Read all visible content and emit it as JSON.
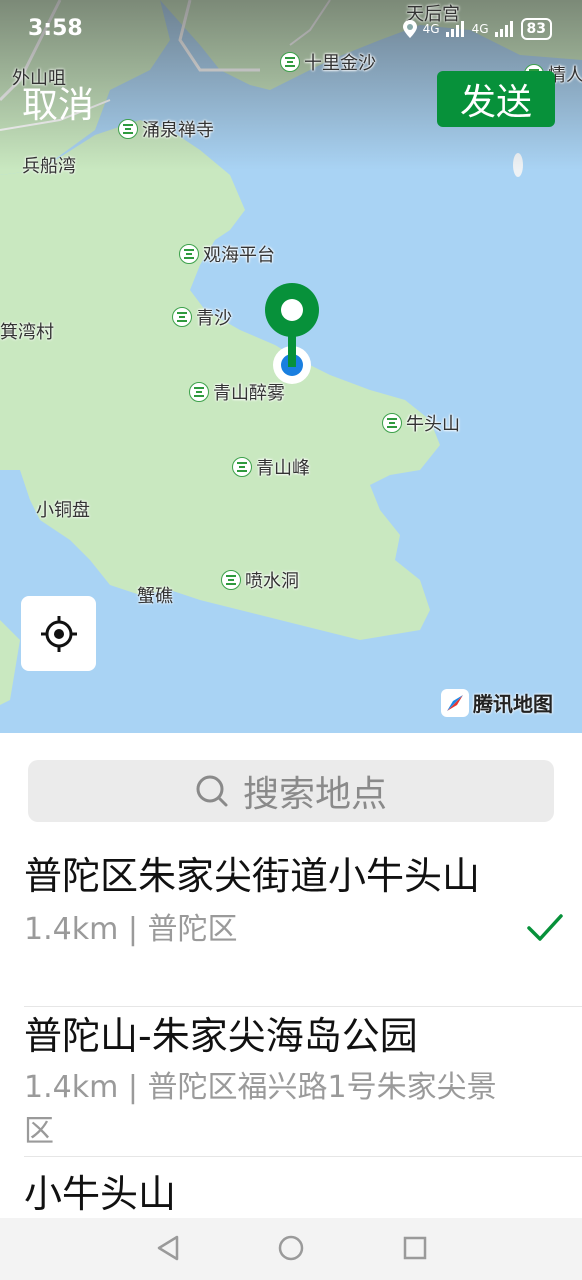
{
  "status": {
    "time": "3:58",
    "battery": "83",
    "network_1": "4G",
    "network_2": "4G"
  },
  "header": {
    "cancel_label": "取消",
    "send_label": "发送"
  },
  "map": {
    "pois": [
      "十里金沙",
      "涌泉禅寺",
      "观海平台",
      "青沙",
      "青山醉雾",
      "牛头山",
      "青山峰",
      "喷水洞",
      "情人"
    ],
    "places": [
      "天后宫",
      "外山咀",
      "兵船湾",
      "箕湾村",
      "小铜盘",
      "蟹礁"
    ],
    "watermark": "腾讯地图",
    "icons": {
      "locate": "crosshair-icon",
      "pin": "map-pin-icon",
      "poi": "scenic-spot-icon"
    },
    "colors": {
      "water": "#a9d3f4",
      "land": "#c9e8c0",
      "pin": "#07913a",
      "location_dot": "#1a7fe0"
    }
  },
  "search": {
    "placeholder": "搜索地点"
  },
  "results": [
    {
      "title": "普陀区朱家尖街道小牛头山",
      "subtitle": "1.4km | 普陀区",
      "selected": true
    },
    {
      "title": "普陀山-朱家尖海岛公园",
      "subtitle": "1.4km | 普陀区福兴路1号朱家尖景区",
      "selected": false
    },
    {
      "title": "小牛头山",
      "subtitle": "",
      "selected": false
    }
  ],
  "accent": "#07913a"
}
